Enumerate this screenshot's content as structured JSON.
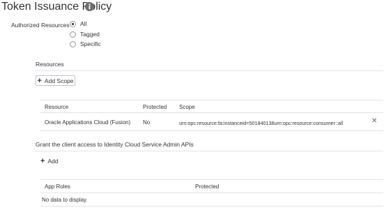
{
  "page": {
    "title": "Token Issuance Policy",
    "info_icon": "info-icon"
  },
  "authorized_resources": {
    "label": "Authorized Resources",
    "options": [
      {
        "label": "All",
        "checked": true
      },
      {
        "label": "Tagged",
        "checked": false
      },
      {
        "label": "Specific",
        "checked": false
      }
    ]
  },
  "resources": {
    "title": "Resources",
    "add_scope_label": "Add Scope",
    "columns": {
      "resource": "Resource",
      "protected": "Protected",
      "scope": "Scope"
    },
    "rows": [
      {
        "resource": "Oracle Applications Cloud (Fusion)",
        "protected": "No",
        "scope": "urn:opc:resource:fa:instanceid=501840138urn:opc:resource:consumer::all"
      }
    ]
  },
  "admin_apis": {
    "title": "Grant the client access to Identity Cloud Service Admin APIs",
    "add_label": "Add",
    "columns": {
      "app_roles": "App Roles",
      "protected": "Protected"
    },
    "empty_text": "No data to display."
  }
}
